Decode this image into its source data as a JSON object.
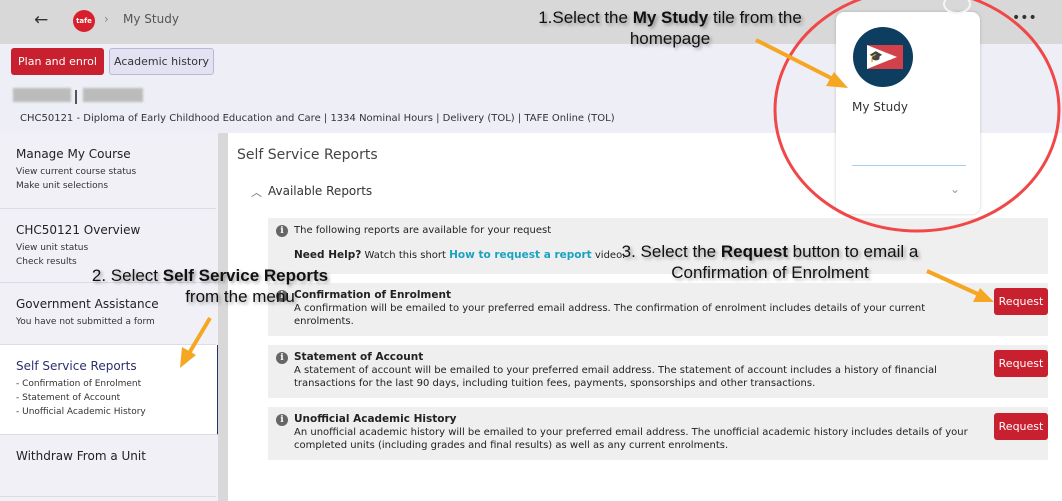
{
  "header": {
    "breadcrumb": "My Study",
    "logo_text": "tafe",
    "more": "•••"
  },
  "toolbar": {
    "plan_enrol": "Plan and enrol",
    "academic_history": "Academic history"
  },
  "course": {
    "details": "CHC50121 - Diploma of Early Childhood Education and Care | 1334 Nominal Hours | Delivery (TOL) | TAFE Online (TOL)"
  },
  "sidebar": {
    "items": [
      {
        "title": "Manage My Course",
        "sub": [
          "View current course status",
          "Make unit selections"
        ]
      },
      {
        "title": "CHC50121 Overview",
        "sub": [
          "View unit status",
          "Check results"
        ]
      },
      {
        "title": "Government Assistance",
        "sub": [
          "You have not submitted a form"
        ]
      },
      {
        "title": "Self Service Reports",
        "sub": [
          "- Confirmation of Enrolment",
          "- Statement of Account",
          "- Unofficial Academic History"
        ],
        "active": true
      },
      {
        "title": "Withdraw From a Unit",
        "sub": []
      }
    ]
  },
  "main": {
    "title": "Self Service Reports",
    "section": "Available Reports",
    "info": {
      "text": "The following reports are available for your request",
      "help_bold": "Need Help?",
      "help_pre": " Watch this short ",
      "help_link": "How to request a report",
      "help_post": " video."
    },
    "reports": [
      {
        "title": "Confirmation of Enrolment",
        "desc": "A confirmation will be emailed to your preferred email address. The confirmation of enrolment includes details of your current enrolments.",
        "button": "Request"
      },
      {
        "title": "Statement of Account",
        "desc": "A statement of account will be emailed to your preferred email address. The statement of account includes a history of financial transactions for the last 90 days, including tuition fees, payments, sponsorships and other transactions.",
        "button": "Request"
      },
      {
        "title": "Unofficial Academic History",
        "desc": "An unofficial academic history will be emailed to your preferred email address. The unofficial academic history includes details of your completed units (including grades and final results) as well as any current enrolments.",
        "button": "Request"
      }
    ]
  },
  "tile": {
    "label": "My Study"
  },
  "annotations": {
    "a1_pre": "1.Select the ",
    "a1_bold": "My Study",
    "a1_post": " tile from the homepage",
    "a2_pre": "2. Select ",
    "a2_bold": "Self Service Reports",
    "a2_post": "from the menu",
    "a3_pre": "3. Select the ",
    "a3_bold": "Request",
    "a3_post": " button to email a Confirmation of Enrolment"
  },
  "colors": {
    "brand_red": "#c8202f",
    "nav_accent": "#2b2f6e",
    "link": "#1aa3c0",
    "arrow": "#f5a623",
    "circle": "#f04848"
  }
}
